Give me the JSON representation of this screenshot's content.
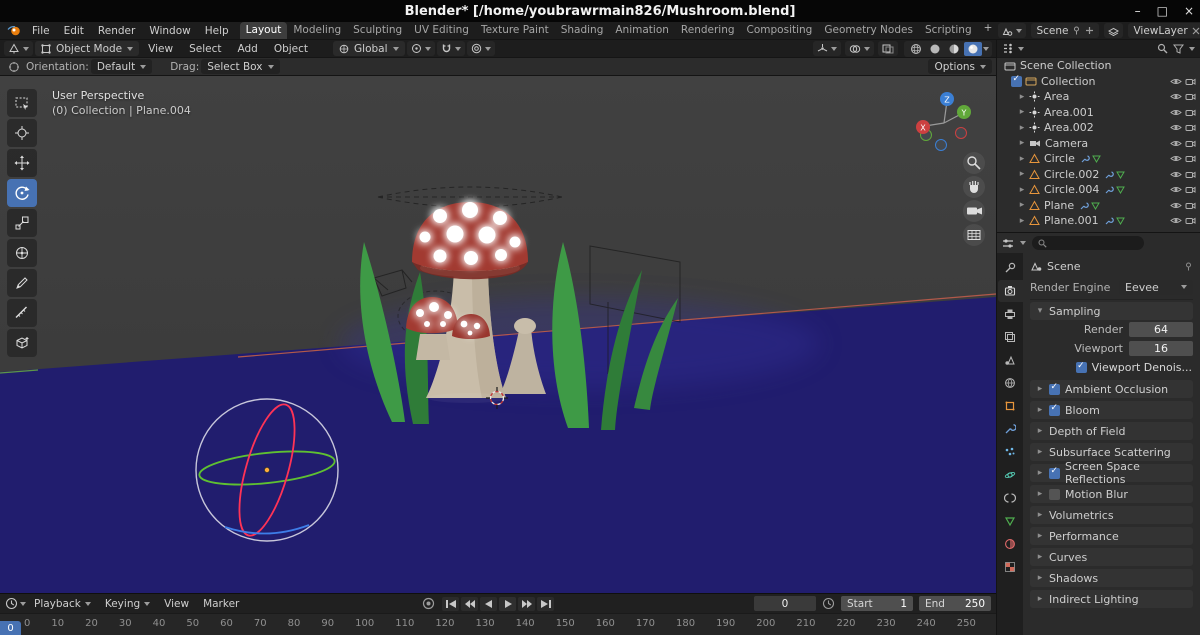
{
  "window": {
    "title": "Blender* [/home/youbrawrmain826/Mushroom.blend]",
    "controls": {
      "minimize": "–",
      "maximize": "□",
      "close": "×"
    }
  },
  "menubar": {
    "menus": [
      "File",
      "Edit",
      "Render",
      "Window",
      "Help"
    ],
    "workspaces": [
      {
        "label": "Layout",
        "active": true
      },
      {
        "label": "Modeling"
      },
      {
        "label": "Sculpting"
      },
      {
        "label": "UV Editing"
      },
      {
        "label": "Texture Paint"
      },
      {
        "label": "Shading"
      },
      {
        "label": "Animation"
      },
      {
        "label": "Rendering"
      },
      {
        "label": "Compositing"
      },
      {
        "label": "Geometry Nodes"
      },
      {
        "label": "Scripting"
      }
    ],
    "add_workspace": "+",
    "scene_value": "Scene",
    "view_layer_value": "ViewLayer"
  },
  "tool_header": {
    "mode_value": "Object Mode",
    "menus": [
      "View",
      "Select",
      "Add",
      "Object"
    ],
    "orientation_value": "Global"
  },
  "options_bar": {
    "orientation_label": "Orientation:",
    "orientation_value": "Default",
    "drag_label": "Drag:",
    "drag_value": "Select Box",
    "options_label": "Options"
  },
  "viewport": {
    "view_label": "User Perspective",
    "context_label": "(0) Collection | Plane.004",
    "axes": {
      "x": "X",
      "y": "Y",
      "z": "Z"
    }
  },
  "outliner": {
    "root_label": "Scene Collection",
    "collection_label": "Collection",
    "items": [
      {
        "name": "Area",
        "type": "light"
      },
      {
        "name": "Area.001",
        "type": "light"
      },
      {
        "name": "Area.002",
        "type": "light"
      },
      {
        "name": "Camera",
        "type": "camera"
      },
      {
        "name": "Circle",
        "type": "mesh"
      },
      {
        "name": "Circle.002",
        "type": "mesh"
      },
      {
        "name": "Circle.004",
        "type": "mesh"
      },
      {
        "name": "Plane",
        "type": "mesh"
      },
      {
        "name": "Plane.001",
        "type": "mesh"
      }
    ]
  },
  "properties": {
    "breadcrumb_value": "Scene",
    "render_engine_label": "Render Engine",
    "render_engine_value": "Eevee",
    "sampling": {
      "title": "Sampling",
      "render_label": "Render",
      "render_value": "64",
      "viewport_label": "Viewport",
      "viewport_value": "16",
      "denoise_label": "Viewport Denois..."
    },
    "sections": [
      {
        "label": "Ambient Occlusion",
        "state": "checked"
      },
      {
        "label": "Bloom",
        "state": "checked"
      },
      {
        "label": "Depth of Field",
        "state": "none"
      },
      {
        "label": "Subsurface Scattering",
        "state": "none"
      },
      {
        "label": "Screen Space Reflections",
        "state": "checked"
      },
      {
        "label": "Motion Blur",
        "state": "unchecked"
      },
      {
        "label": "Volumetrics",
        "state": "none"
      },
      {
        "label": "Performance",
        "state": "none"
      },
      {
        "label": "Curves",
        "state": "none"
      },
      {
        "label": "Shadows",
        "state": "none"
      },
      {
        "label": "Indirect Lighting",
        "state": "none"
      }
    ]
  },
  "timeline": {
    "menus": [
      {
        "label": "Playback",
        "caret": true
      },
      {
        "label": "Keying",
        "caret": true
      },
      {
        "label": "View",
        "caret": false
      },
      {
        "label": "Marker",
        "caret": false
      }
    ],
    "current_frame": "0",
    "start_label": "Start",
    "start_value": "1",
    "end_label": "End",
    "end_value": "250",
    "playhead_label": "0",
    "ticks": [
      "0",
      "10",
      "20",
      "30",
      "40",
      "50",
      "60",
      "70",
      "80",
      "90",
      "100",
      "110",
      "120",
      "130",
      "140",
      "150",
      "160",
      "170",
      "180",
      "190",
      "200",
      "210",
      "220",
      "230",
      "240",
      "250"
    ]
  },
  "icons": {
    "expand_right": "▸",
    "collapse_down": "▾"
  },
  "colors": {
    "accent": "#4772b3",
    "ground_blue": "#211d6e",
    "mushroom_red": "#a23a31",
    "leaf_green": "#3e9a46"
  }
}
